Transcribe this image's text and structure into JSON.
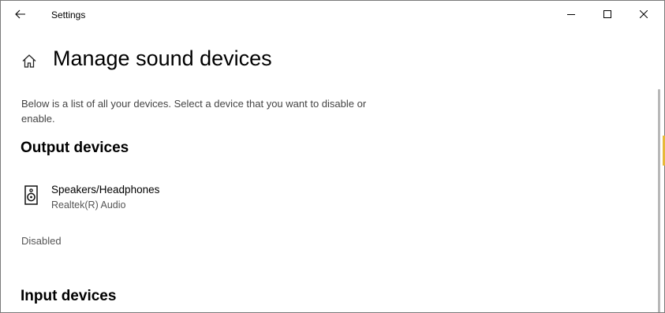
{
  "window": {
    "title": "Settings"
  },
  "page": {
    "title": "Manage sound devices",
    "description": "Below is a list of all your devices. Select a device that you want to disable or enable."
  },
  "output": {
    "heading": "Output devices",
    "devices": [
      {
        "name": "Speakers/Headphones",
        "subtitle": "Realtek(R) Audio",
        "icon": "speaker-icon"
      }
    ],
    "status": "Disabled"
  },
  "input": {
    "heading": "Input devices"
  },
  "colors": {
    "background": "#ffffff",
    "text": "#000000",
    "secondary_text": "#555555",
    "edge_accent": "#e6b93a"
  }
}
